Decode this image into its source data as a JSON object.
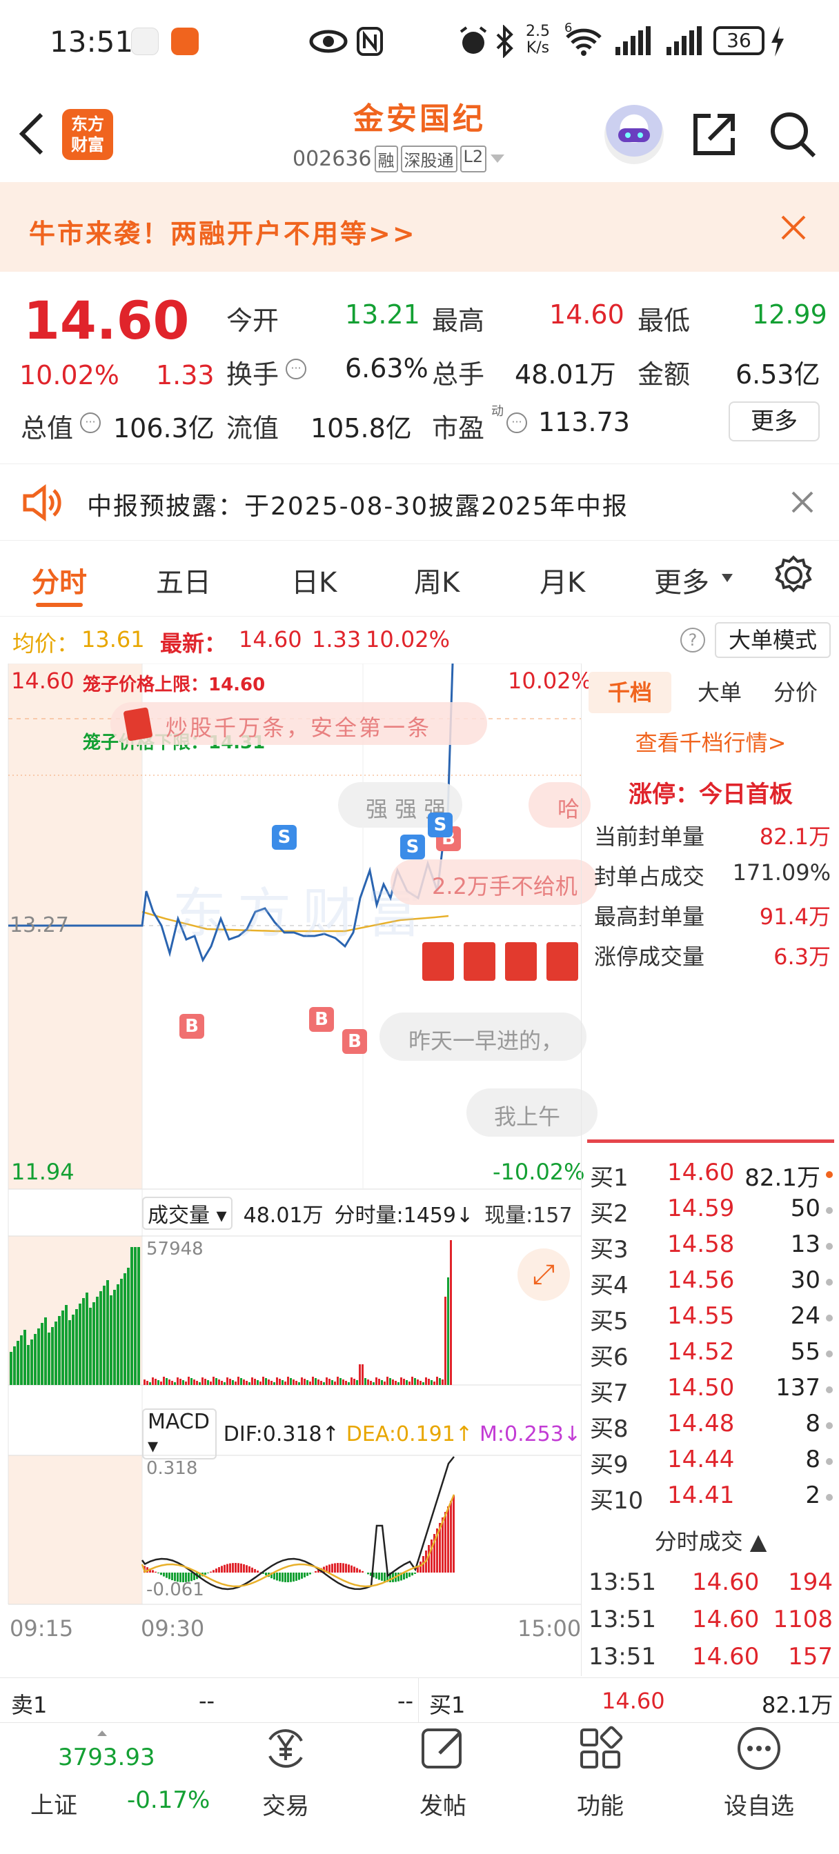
{
  "status_bar": {
    "time": "13:51",
    "net_speed_top": "2.5",
    "net_speed_bottom": "K/s",
    "wifi_badge": "6",
    "battery": "36"
  },
  "header": {
    "title": "金安国纪",
    "code": "002636",
    "badges": [
      "融",
      "深股通",
      "L2"
    ],
    "logo_line1": "东方",
    "logo_line2": "财富"
  },
  "banner": {
    "text": "牛市来袭！两融开户不用等>>"
  },
  "quote": {
    "price": "14.60",
    "change_pct": "10.02%",
    "change": "1.33",
    "open_label": "今开",
    "open": "13.21",
    "high_label": "最高",
    "high": "14.60",
    "low_label": "最低",
    "low": "12.99",
    "turnover_label": "换手",
    "turnover": "6.63%",
    "volume_label": "总手",
    "volume": "48.01万",
    "amount_label": "金额",
    "amount": "6.53亿",
    "mktcap_label": "总值",
    "mktcap": "106.3亿",
    "float_label": "流值",
    "float_cap": "105.8亿",
    "pe_label": "市盈",
    "pe_sup": "动",
    "pe": "113.73",
    "more_button": "更多"
  },
  "notice": {
    "text": "中报预披露：于2025-08-30披露2025年中报"
  },
  "tabs": [
    {
      "label": "分时"
    },
    {
      "label": "五日"
    },
    {
      "label": "日K"
    },
    {
      "label": "周K"
    },
    {
      "label": "月K"
    },
    {
      "label": "更多"
    }
  ],
  "info_line": {
    "avg_label": "均价：",
    "avg": "13.61",
    "latest_label": "最新：",
    "latest": "14.60",
    "chg": "1.33",
    "pct": "10.02%",
    "big_order_button": "大单模式"
  },
  "chart": {
    "price_top": "14.60",
    "price_bottom": "11.94",
    "price_mid": "13.27",
    "pct_top": "10.02%",
    "pct_bottom": "-10.02%",
    "upper_limit_text": "笼子价格上限：14.60",
    "lower_limit_text": "笼子价格下限：14.31",
    "comments": [
      "炒股千万条，安全第一条",
      "强 强 强",
      "哈",
      "2.2万手不给机",
      "昨天一早进的，",
      "我上午"
    ],
    "signals_b": [
      "B",
      "B",
      "B",
      "B"
    ],
    "signals_s": [
      "S",
      "S",
      "S"
    ],
    "watermark": "东方财富",
    "vol_selector": "成交量",
    "vol_total": "48.01万",
    "vol_min_label": "分时量:1459↓",
    "vol_now_label": "现量:157",
    "vol_max": "57948",
    "macd_selector": "MACD",
    "dif": "DIF:0.318↑",
    "dea": "DEA:0.191↑",
    "m": "M:0.253↓",
    "macd_top": "0.318",
    "macd_bottom": "-0.061",
    "time_start": "09:15",
    "time_open": "09:30",
    "time_end": "15:00"
  },
  "side": {
    "tabs": [
      "千档",
      "大单",
      "分价"
    ],
    "view_link": "查看千档行情>",
    "limit_title": "涨停：今日首板",
    "limit_rows": [
      {
        "label": "当前封单量",
        "value": "82.1万"
      },
      {
        "label": "封单占成交",
        "value": "171.09%"
      },
      {
        "label": "最高封单量",
        "value": "91.4万"
      },
      {
        "label": "涨停成交量",
        "value": "6.3万"
      }
    ],
    "bids": [
      {
        "name": "买1",
        "price": "14.60",
        "qty": "82.1万"
      },
      {
        "name": "买2",
        "price": "14.59",
        "qty": "50"
      },
      {
        "name": "买3",
        "price": "14.58",
        "qty": "13"
      },
      {
        "name": "买4",
        "price": "14.56",
        "qty": "30"
      },
      {
        "name": "买5",
        "price": "14.55",
        "qty": "24"
      },
      {
        "name": "买6",
        "price": "14.52",
        "qty": "55"
      },
      {
        "name": "买7",
        "price": "14.50",
        "qty": "137"
      },
      {
        "name": "买8",
        "price": "14.48",
        "qty": "8"
      },
      {
        "name": "买9",
        "price": "14.44",
        "qty": "8"
      },
      {
        "name": "买10",
        "price": "14.41",
        "qty": "2"
      }
    ],
    "trades_title": "分时成交",
    "trades": [
      {
        "time": "13:51",
        "price": "14.60",
        "qty": "194"
      },
      {
        "time": "13:51",
        "price": "14.60",
        "qty": "1108"
      },
      {
        "time": "13:51",
        "price": "14.60",
        "qty": "157"
      }
    ]
  },
  "bottom_bar": {
    "sell_label": "卖1",
    "sell_price": "--",
    "sell_qty": "--",
    "buy_label": "买1",
    "buy_price": "14.60",
    "buy_qty": "82.1万"
  },
  "nav": {
    "index_value": "3793.93",
    "index_name": "上证",
    "index_pct": "-0.17%",
    "items": [
      {
        "label": "交易"
      },
      {
        "label": "发帖"
      },
      {
        "label": "功能"
      },
      {
        "label": "设自选"
      }
    ]
  },
  "colors": {
    "up": "#e0242b",
    "down": "#13a033",
    "accent": "#f0641e",
    "price_line": "#2a64b0",
    "avg_line": "#e8b02a"
  }
}
